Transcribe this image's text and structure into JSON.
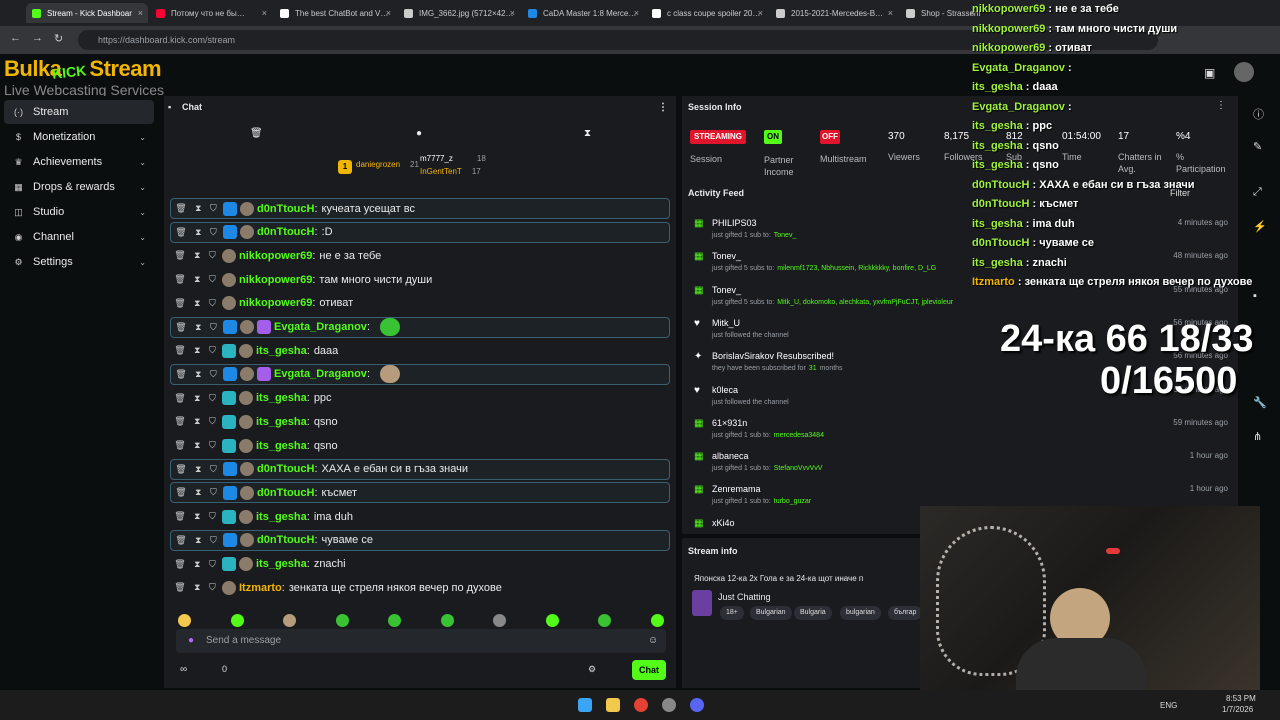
{
  "browser": {
    "tabs": [
      {
        "title": "Stream - Kick Dashboar",
        "active": true,
        "color": "#53fc18"
      },
      {
        "title": "Потому что не бы…",
        "color": "#ff0033"
      },
      {
        "title": "The best ChatBot and V…",
        "color": "#ffffff"
      },
      {
        "title": "IMG_3662.jpg (5712×42…",
        "color": "#cccccc"
      },
      {
        "title": "CaDA Master 1:8 Merce…",
        "color": "#1e88e5"
      },
      {
        "title": "c class coupe spoiler 20…",
        "color": "#ffffff"
      },
      {
        "title": "2015-2021-Mercedes-B…",
        "color": "#cccccc"
      },
      {
        "title": "Shop - Strassent…",
        "color": "#cccccc"
      }
    ],
    "url": "https://dashboard.kick.com/stream"
  },
  "logo": {
    "line1": "Bulka",
    "kick": "KICK",
    "line1b": "Stream",
    "line2": "Live Webcasting Services"
  },
  "nav": {
    "items": [
      {
        "label": "Stream",
        "icon": "stream-icon",
        "active": true
      },
      {
        "label": "Monetization",
        "icon": "dollar-icon"
      },
      {
        "label": "Achievements",
        "icon": "trophy-icon"
      },
      {
        "label": "Drops & rewards",
        "icon": "gift-icon"
      },
      {
        "label": "Studio",
        "icon": "studio-icon"
      },
      {
        "label": "Channel",
        "icon": "user-icon"
      },
      {
        "label": "Settings",
        "icon": "gear-icon"
      }
    ]
  },
  "chat": {
    "title": "Chat",
    "top_gifters": [
      {
        "name": "daniegrozen",
        "count": "21"
      },
      {
        "name": "m7777_z",
        "count": "18"
      },
      {
        "name": "InGentTenT",
        "count": "17"
      }
    ],
    "messages": [
      {
        "user": "d0nTtoucH",
        "text": "кучеата усещат вс",
        "hl": true
      },
      {
        "user": "d0nTtoucH",
        "text": ":D",
        "hl": true
      },
      {
        "user": "nikkopower69",
        "text": "не е за тебе"
      },
      {
        "user": "nikkopower69",
        "text": "там много чисти души"
      },
      {
        "user": "nikkopower69",
        "text": "отиват"
      },
      {
        "user": "Evgata_Draganov",
        "text": "",
        "hl": true,
        "emote": true
      },
      {
        "user": "its_gesha",
        "text": "daaa"
      },
      {
        "user": "Evgata_Draganov",
        "text": "",
        "hl": true,
        "emote": true
      },
      {
        "user": "its_gesha",
        "text": "ppc"
      },
      {
        "user": "its_gesha",
        "text": "qsno"
      },
      {
        "user": "its_gesha",
        "text": "qsno"
      },
      {
        "user": "d0nTtoucH",
        "text": "ХАХА е ебан си в гъза значи",
        "hl": true
      },
      {
        "user": "d0nTtoucH",
        "text": "късмет",
        "hl": true
      },
      {
        "user": "its_gesha",
        "text": "ima duh"
      },
      {
        "user": "d0nTtoucH",
        "text": "чуваме се",
        "hl": true
      },
      {
        "user": "its_gesha",
        "text": "znachi"
      },
      {
        "user": "Itzmarto",
        "text": "зенката ще стреля някоя вечер по духове"
      }
    ],
    "placeholder": "Send a message",
    "send_label": "Chat",
    "points": "0"
  },
  "session": {
    "title": "Session Info",
    "streaming": "STREAMING",
    "on": "ON",
    "off": "OFF",
    "labels": [
      "Session",
      "Partner Income",
      "Multistream"
    ],
    "stats": [
      {
        "value": "370",
        "label": "Viewers"
      },
      {
        "value": "8,175",
        "label": "Followers"
      },
      {
        "value": "812",
        "label": "Sub"
      },
      {
        "value": "01:54:00",
        "label": "Time"
      },
      {
        "value": "17",
        "label": "Chatters in Avg."
      },
      {
        "value": "%4",
        "label": "% Participation"
      }
    ]
  },
  "activity": {
    "title": "Activity Feed",
    "filter": "Filter",
    "items": [
      {
        "name": "PHILIPS03",
        "sub": "just gifted 1 sub to:",
        "targets": "Tonev_",
        "time": "4 minutes ago",
        "icon": "gift-icon"
      },
      {
        "name": "Tonev_",
        "sub": "just gifted 5 subs to:",
        "targets": "milenmf1723, Nbhussein, Rickkkkky, bonfire, D_LG",
        "time": "48 minutes ago",
        "icon": "gift-icon"
      },
      {
        "name": "Tonev_",
        "sub": "just gifted 5 subs to:",
        "targets": "Mitk_U, dokomoko, alechkata, yxvfmPjFuCJT, jplevioleur",
        "time": "55 minutes ago",
        "icon": "gift-icon"
      },
      {
        "name": "Mitk_U",
        "sub": "just followed the channel",
        "targets": "",
        "time": "56 minutes ago",
        "icon": "heart-icon"
      },
      {
        "name": "BorislavSirakov Resubscribed!",
        "sub": "they have been subscribed for",
        "targets": "31",
        "suffix": "months",
        "time": "56 minutes ago",
        "icon": "star-icon"
      },
      {
        "name": "k0leca",
        "sub": "just followed the channel",
        "targets": "",
        "time": "58 minutes ago",
        "icon": "heart-icon"
      },
      {
        "name": "61×931n",
        "sub": "just gifted 1 sub to:",
        "targets": "mercedesa3484",
        "time": "59 minutes ago",
        "icon": "gift-icon"
      },
      {
        "name": "albaneca",
        "sub": "just gifted 1 sub to:",
        "targets": "StefanoVvvVvV",
        "time": "1 hour ago",
        "icon": "gift-icon"
      },
      {
        "name": "Zenremama",
        "sub": "just gifted 1 sub to:",
        "targets": "turbo_guzar",
        "time": "1 hour ago",
        "icon": "gift-icon"
      },
      {
        "name": "xKi4o",
        "sub": "",
        "targets": "",
        "time": "",
        "icon": "gift-icon"
      }
    ]
  },
  "stream_info": {
    "title": "Stream info",
    "stream_title": "Японска 12-ка 2х Гола е за 24-ка щот иначе п",
    "category": "Just Chatting",
    "tags": [
      "18+",
      "Bulgarian",
      "Bulgaria",
      "bulgarian",
      "българ"
    ]
  },
  "overlay": {
    "lines": [
      {
        "user": "nikkopower69",
        "text": "не е за тебе"
      },
      {
        "user": "nikkopower69",
        "text": "там много чисти души"
      },
      {
        "user": "nikkopower69",
        "text": "отиват"
      },
      {
        "user": "Evgata_Draganov",
        "text": ""
      },
      {
        "user": "its_gesha",
        "text": "daaa"
      },
      {
        "user": "Evgata_Draganov",
        "text": ""
      },
      {
        "user": "its_gesha",
        "text": "ppc"
      },
      {
        "user": "its_gesha",
        "text": "qsno"
      },
      {
        "user": "its_gesha",
        "text": "qsno"
      },
      {
        "user": "d0nTtoucH",
        "text": "ХАХА е ебан си в гъза значи"
      },
      {
        "user": "d0nTtoucH",
        "text": "късмет"
      },
      {
        "user": "its_gesha",
        "text": "ima duh"
      },
      {
        "user": "d0nTtoucH",
        "text": "чуваме се"
      },
      {
        "user": "its_gesha",
        "text": "znachi"
      },
      {
        "user": "Itzmarto",
        "text": "зенката ще стреля някоя вечер по духове"
      }
    ],
    "big1": "24-ка 66 18/33",
    "big2": "0/16500"
  },
  "taskbar": {
    "lang": "ENG",
    "time": "8:53 PM",
    "date": "1/7/2026"
  }
}
